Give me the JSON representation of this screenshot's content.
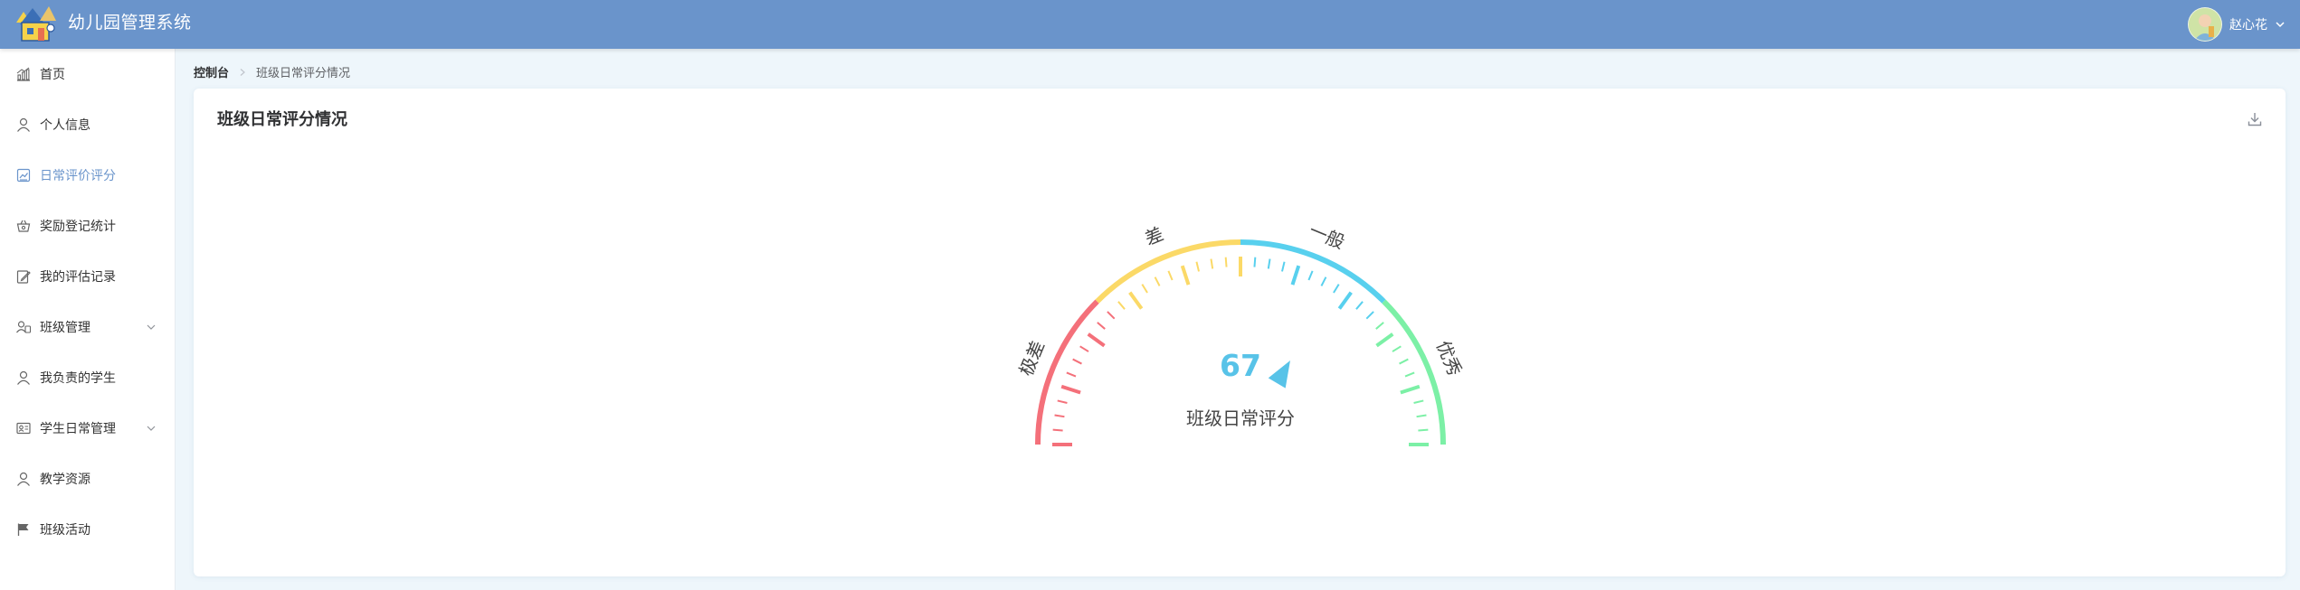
{
  "app": {
    "title": "幼儿园管理系统"
  },
  "user": {
    "name": "赵心花"
  },
  "sidebar": {
    "items": [
      {
        "label": "首页",
        "icon": "chart-icon"
      },
      {
        "label": "个人信息",
        "icon": "user-icon"
      },
      {
        "label": "日常评价评分",
        "icon": "report-icon",
        "active": true
      },
      {
        "label": "奖励登记统计",
        "icon": "basket-icon"
      },
      {
        "label": "我的评估记录",
        "icon": "edit-icon"
      },
      {
        "label": "班级管理",
        "icon": "users-icon",
        "expandable": true
      },
      {
        "label": "我负责的学生",
        "icon": "user-icon"
      },
      {
        "label": "学生日常管理",
        "icon": "id-card-icon",
        "expandable": true
      },
      {
        "label": "教学资源",
        "icon": "user-icon"
      },
      {
        "label": "班级活动",
        "icon": "flag-icon"
      }
    ]
  },
  "breadcrumb": {
    "root": "控制台",
    "current": "班级日常评分情况"
  },
  "card": {
    "title": "班级日常评分情况"
  },
  "chart_data": {
    "type": "gauge",
    "value": 67,
    "min": 0,
    "max": 100,
    "label": "班级日常评分",
    "value_color": "#58c3e8",
    "bands": [
      {
        "name": "极差",
        "from": 0,
        "to": 25,
        "color": "#f4707a"
      },
      {
        "name": "差",
        "from": 25,
        "to": 50,
        "color": "#fbd967"
      },
      {
        "name": "一般",
        "from": 50,
        "to": 75,
        "color": "#58d0ee"
      },
      {
        "name": "优秀",
        "from": 75,
        "to": 100,
        "color": "#7cf0a6"
      }
    ]
  }
}
